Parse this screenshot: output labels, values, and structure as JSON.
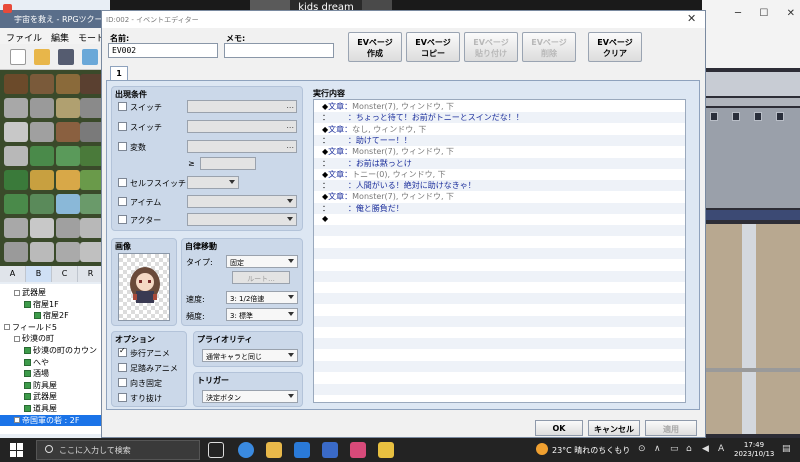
{
  "background_app": {
    "title": "宇宙を救え - RPGツクールMV",
    "menu": [
      "ファイル",
      "編集",
      "モード"
    ],
    "tile_tabs": [
      "A",
      "B",
      "C",
      "R"
    ],
    "tree": [
      {
        "label": "武器屋",
        "indent": 1,
        "type": "box"
      },
      {
        "label": "宿屋1F",
        "indent": 2,
        "type": "map"
      },
      {
        "label": "宿屋2F",
        "indent": 3,
        "type": "map"
      },
      {
        "label": "フィールド5",
        "indent": 0,
        "type": "box"
      },
      {
        "label": "砂漠の町",
        "indent": 1,
        "type": "box"
      },
      {
        "label": "砂漠の町のカウン",
        "indent": 2,
        "type": "map"
      },
      {
        "label": "へや",
        "indent": 2,
        "type": "map"
      },
      {
        "label": "酒場",
        "indent": 2,
        "type": "map"
      },
      {
        "label": "防具屋",
        "indent": 2,
        "type": "map"
      },
      {
        "label": "武器屋",
        "indent": 2,
        "type": "map"
      },
      {
        "label": "道具屋",
        "indent": 2,
        "type": "map"
      },
      {
        "label": "帝国軍の砦 : 2F",
        "indent": 1,
        "type": "box",
        "selected": true
      }
    ]
  },
  "video_overlay": "kids dream club",
  "dialog": {
    "title": "ID:002 - イベントエディター",
    "name_label": "名前:",
    "name_value": "EV002",
    "memo_label": "メモ:",
    "memo_value": "",
    "buttons": [
      {
        "line1": "EVページ",
        "line2": "作成",
        "enabled": true
      },
      {
        "line1": "EVページ",
        "line2": "コピー",
        "enabled": true
      },
      {
        "line1": "EVページ",
        "line2": "貼り付け",
        "enabled": false
      },
      {
        "line1": "EVページ",
        "line2": "削除",
        "enabled": false
      },
      {
        "line1": "EVページ",
        "line2": "クリア",
        "enabled": true
      }
    ],
    "page_tab": "1",
    "conditions": {
      "title": "出現条件",
      "switch1": "スイッチ",
      "switch2": "スイッチ",
      "variable": "変数",
      "gte": "≥",
      "self_switch": "セルフスイッチ",
      "item": "アイテム",
      "actor": "アクター",
      "dots": "..."
    },
    "image": {
      "title": "画像"
    },
    "autonomous": {
      "title": "自律移動",
      "type_label": "タイプ:",
      "type_value": "固定",
      "route_button": "ルート...",
      "speed_label": "速度:",
      "speed_value": "3: 1/2倍速",
      "freq_label": "頻度:",
      "freq_value": "3: 標準"
    },
    "options": {
      "title": "オプション",
      "items": [
        {
          "label": "歩行アニメ",
          "checked": true
        },
        {
          "label": "足踏みアニメ",
          "checked": false
        },
        {
          "label": "向き固定",
          "checked": false
        },
        {
          "label": "すり抜け",
          "checked": false
        }
      ]
    },
    "priority": {
      "title": "プライオリティ",
      "value": "通常キャラと同じ"
    },
    "trigger": {
      "title": "トリガー",
      "value": "決定ボタン"
    },
    "contents": {
      "title": "実行内容",
      "rows": [
        {
          "prefix": "◆",
          "label": "文章",
          "sep": "：",
          "text": "Monster(7), ウィンドウ, 下",
          "style": "gray"
        },
        {
          "prefix": "：",
          "label": "",
          "sep": "：",
          "text": "ちょっと待て！お前がトニーとスインだな！！",
          "style": "blue"
        },
        {
          "prefix": "◆",
          "label": "文章",
          "sep": "：",
          "text": "なし, ウィンドウ, 下",
          "style": "gray"
        },
        {
          "prefix": "：",
          "label": "",
          "sep": "：",
          "text": "助けてーー！！",
          "style": "blue"
        },
        {
          "prefix": "◆",
          "label": "文章",
          "sep": "：",
          "text": "Monster(7), ウィンドウ, 下",
          "style": "gray"
        },
        {
          "prefix": "：",
          "label": "",
          "sep": "：",
          "text": "お前は黙っとけ",
          "style": "blue"
        },
        {
          "prefix": "◆",
          "label": "文章",
          "sep": "：",
          "text": "トニー(0), ウィンドウ, 下",
          "style": "gray"
        },
        {
          "prefix": "：",
          "label": "",
          "sep": "：",
          "text": "人間がいる！絶対に助けなきゃ！",
          "style": "blue"
        },
        {
          "prefix": "◆",
          "label": "文章",
          "sep": "：",
          "text": "Monster(7), ウィンドウ, 下",
          "style": "gray"
        },
        {
          "prefix": "：",
          "label": "",
          "sep": "：",
          "text": "俺と勝負だ！",
          "style": "blue"
        },
        {
          "prefix": "◆",
          "label": "",
          "sep": "",
          "text": "",
          "style": "blue"
        }
      ]
    },
    "ok": "OK",
    "cancel": "キャンセル",
    "apply": "適用"
  },
  "taskbar": {
    "search_placeholder": "ここに入力して検索",
    "weather": "23°C  晴れのちくもり",
    "time": "17:49",
    "date": "2023/10/13",
    "ime": "A"
  }
}
